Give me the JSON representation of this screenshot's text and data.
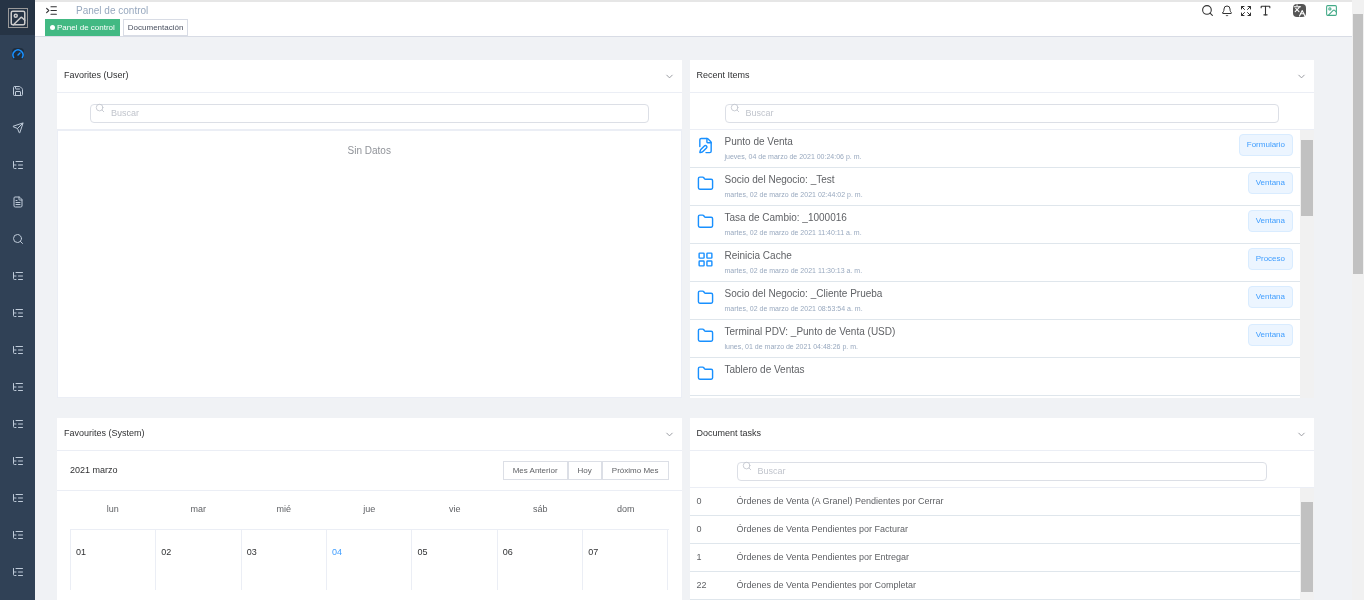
{
  "header": {
    "title": "Panel de control"
  },
  "sidebar": {
    "items": [
      {
        "kind": "dashboard",
        "selected": true
      },
      {
        "kind": "window",
        "selected": false
      },
      {
        "kind": "send",
        "selected": false
      },
      {
        "kind": "list",
        "selected": false
      },
      {
        "kind": "report",
        "selected": false
      },
      {
        "kind": "search",
        "selected": false
      },
      {
        "kind": "tree",
        "selected": false
      },
      {
        "kind": "tree",
        "selected": false
      },
      {
        "kind": "tree",
        "selected": false
      },
      {
        "kind": "tree",
        "selected": false
      },
      {
        "kind": "tree",
        "selected": false
      },
      {
        "kind": "tree",
        "selected": false
      },
      {
        "kind": "tree",
        "selected": false
      },
      {
        "kind": "tree",
        "selected": false
      },
      {
        "kind": "tree",
        "selected": false
      }
    ]
  },
  "tabs": [
    {
      "label": "Panel de control",
      "selected": true
    },
    {
      "label": "Documentación",
      "selected": false
    }
  ],
  "favorites_user": {
    "title": "Favorites (User)",
    "search": {
      "placeholder": "Buscar"
    },
    "empty": "Sin Datos"
  },
  "recent_items": {
    "title": "Recent Items",
    "search": {
      "placeholder": "Buscar"
    },
    "items": [
      {
        "kind": "form",
        "name": "Punto de Venta",
        "date": "jueves, 04 de marzo de 2021 00:24:06 p. m.",
        "badge": "Formulario"
      },
      {
        "kind": "window",
        "name": "Socio del Negocio: _Test",
        "date": "martes, 02 de marzo de 2021 02:44:02 p. m.",
        "badge": "Ventana"
      },
      {
        "kind": "window",
        "name": "Tasa de Cambio: _1000016",
        "date": "martes, 02 de marzo de 2021 11:40:11 a. m.",
        "badge": "Ventana"
      },
      {
        "kind": "process",
        "name": "Reinicia Cache",
        "date": "martes, 02 de marzo de 2021 11:30:13 a. m.",
        "badge": "Proceso"
      },
      {
        "kind": "window",
        "name": "Socio del Negocio: _Cliente Prueba",
        "date": "martes, 02 de marzo de 2021 08:53:54 a. m.",
        "badge": "Ventana"
      },
      {
        "kind": "window",
        "name": "Terminal PDV: _Punto de Venta (USD)",
        "date": "lunes, 01 de marzo de 2021 04:48:26 p. m.",
        "badge": "Ventana"
      },
      {
        "kind": "window",
        "name": "Tablero de Ventas"
      }
    ]
  },
  "favorites_system": {
    "title": "Favourites (System)",
    "month": "2021 marzo",
    "buttons": [
      "Mes Anterior",
      "Hoy",
      "Próximo Mes"
    ],
    "weekdays": [
      "lun",
      "mar",
      "mié",
      "jue",
      "vie",
      "sáb",
      "dom"
    ],
    "days": [
      {
        "label": "01",
        "today": false
      },
      {
        "label": "02",
        "today": false
      },
      {
        "label": "03",
        "today": false
      },
      {
        "label": "04",
        "today": true
      },
      {
        "label": "05",
        "today": false
      },
      {
        "label": "06",
        "today": false
      },
      {
        "label": "07",
        "today": false
      }
    ]
  },
  "document_tasks": {
    "title": "Document tasks",
    "search": {
      "placeholder": "Buscar"
    },
    "rows": [
      {
        "count": "0",
        "name": "Órdenes de Venta (A Granel) Pendientes por Cerrar"
      },
      {
        "count": "0",
        "name": "Órdenes de Venta Pendientes por Facturar"
      },
      {
        "count": "1",
        "name": "Órdenes de Venta Pendientes por Entregar"
      },
      {
        "count": "22",
        "name": "Órdenes de Venta Pendientes por Completar"
      }
    ]
  }
}
